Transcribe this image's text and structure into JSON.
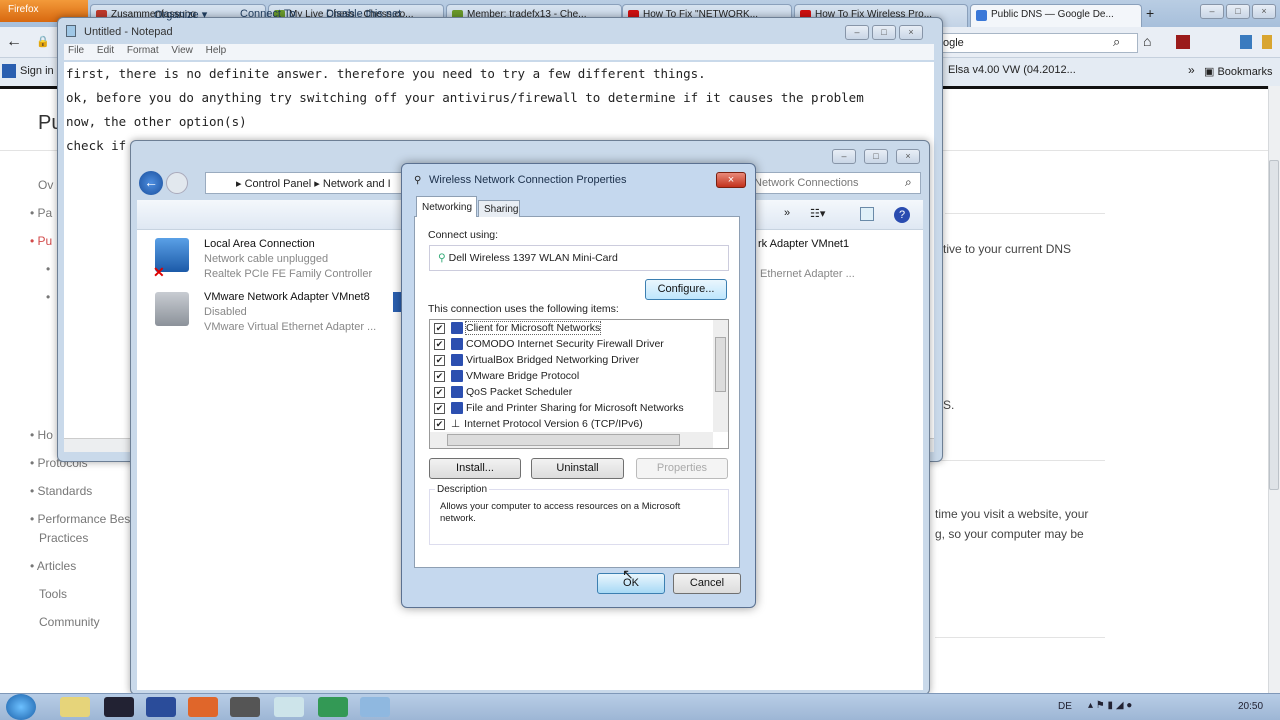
{
  "browser": {
    "app_button": "Firefox",
    "tabs": [
      {
        "label": "Zusammenfassung",
        "color": "#c0392b"
      },
      {
        "label": "My Live Chess - Chess.co...",
        "color": "#6a9a2b"
      },
      {
        "label": "Member: tradefx13 - Che...",
        "color": "#6a9a2b"
      },
      {
        "label": "How To Fix \"NETWORK...",
        "color": "#d01010"
      },
      {
        "label": "How To Fix Wireless Pro...",
        "color": "#d01010"
      },
      {
        "label": "Public DNS — Google De...",
        "color": "#3a78d8"
      }
    ],
    "new_tab": "+",
    "url_fragment": "ogle",
    "bookmarks": {
      "sign_in": "Sign in",
      "elsa": "Elsa v4.00 VW (04.2012...",
      "overflow": "»",
      "bookmarks_label": "Bookmarks"
    }
  },
  "page": {
    "heading_fragment": "Pu",
    "left_nav": [
      "Ov",
      "Pa",
      "Pu",
      "Ho",
      "Protocols",
      "Standards",
      "Performance Best",
      "Practices",
      "Articles",
      "Tools",
      "Community"
    ],
    "right_text": [
      "tive to your current DNS",
      "S.",
      "time you visit a website, your",
      "g, so your computer may be"
    ]
  },
  "notepad": {
    "title": "Untitled - Notepad",
    "menu": [
      "File",
      "Edit",
      "Format",
      "View",
      "Help"
    ],
    "lines": [
      "first, there is no definite answer. therefore you need to try a few different things.",
      "ok, before you do anything try switching off your antivirus/firewall to determine if it causes the problem",
      "now, the other option(s)",
      "check if"
    ]
  },
  "control_panel": {
    "breadcrumb": [
      "Control Panel",
      "Network and I"
    ],
    "search_placeholder": "Network Connections",
    "toolbar": [
      "Organize ▾",
      "Connect To",
      "Disable this net"
    ],
    "connections": [
      {
        "name": "Local Area Connection",
        "status": "Network cable unplugged",
        "device": "Realtek PCIe FE Family Controller"
      },
      {
        "name": "VMware Network Adapter VMnet8",
        "status": "Disabled",
        "device": "VMware Virtual Ethernet Adapter ..."
      },
      {
        "name": "rk Adapter VMnet1",
        "status": "",
        "device": "Ethernet Adapter ..."
      }
    ]
  },
  "dialog": {
    "title": "Wireless Network Connection Properties",
    "tabs": [
      "Networking",
      "Sharing"
    ],
    "connect_using_label": "Connect using:",
    "adapter": "Dell Wireless 1397 WLAN Mini-Card",
    "configure": "Configure...",
    "items_label": "This connection uses the following items:",
    "items": [
      "Client for Microsoft Networks",
      "COMODO Internet Security Firewall Driver",
      "VirtualBox Bridged Networking Driver",
      "VMware Bridge Protocol",
      "QoS Packet Scheduler",
      "File and Printer Sharing for Microsoft Networks",
      "Internet Protocol Version 6 (TCP/IPv6)"
    ],
    "install": "Install...",
    "uninstall": "Uninstall",
    "properties": "Properties",
    "description_label": "Description",
    "description": "Allows your computer to access resources on a Microsoft network.",
    "ok": "OK",
    "cancel": "Cancel"
  },
  "taskbar": {
    "language": "DE",
    "clock": "20:50"
  }
}
